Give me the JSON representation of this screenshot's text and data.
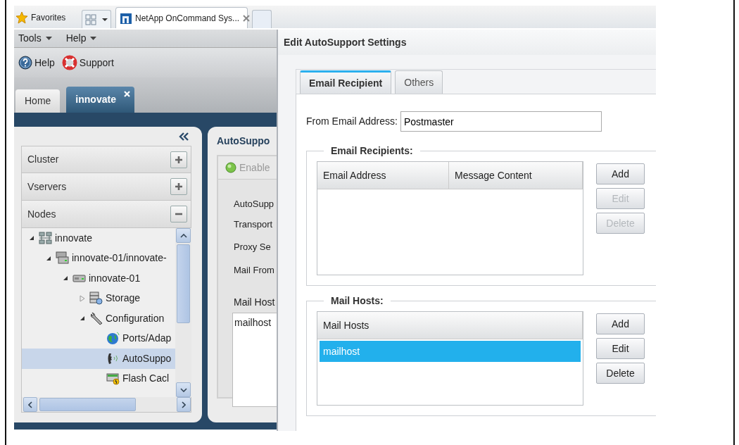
{
  "browser": {
    "favorites": "Favorites",
    "tabs": [
      {
        "title": "NetApp OnCommand Sys...",
        "selected": true
      }
    ]
  },
  "menu": [
    "Tools",
    "Help"
  ],
  "toolbar": [
    {
      "label": "Help",
      "kind": "help"
    },
    {
      "label": "Support",
      "kind": "support"
    }
  ],
  "app_tabs": [
    {
      "label": "Home",
      "selected": false,
      "closable": false
    },
    {
      "label": "innovate",
      "selected": true,
      "closable": true
    }
  ],
  "sidebar": {
    "sections": [
      {
        "label": "Cluster",
        "expanded": false
      },
      {
        "label": "Vservers",
        "expanded": false
      },
      {
        "label": "Nodes",
        "expanded": true
      }
    ],
    "tree": [
      {
        "label": "innovate",
        "kind": "cluster",
        "expanded": true,
        "selected": false,
        "children": [
          {
            "label": "innovate-01/innovate-",
            "kind": "pair",
            "expanded": true,
            "selected": false,
            "children": [
              {
                "label": "innovate-01",
                "kind": "node",
                "expanded": true,
                "selected": false,
                "children": [
                  {
                    "label": "Storage",
                    "kind": "storage",
                    "expanded": false,
                    "selected": false
                  },
                  {
                    "label": "Configuration",
                    "kind": "wrench",
                    "expanded": true,
                    "selected": false,
                    "children": [
                      {
                        "label": "Ports/Adap",
                        "kind": "globe",
                        "selected": false
                      },
                      {
                        "label": "AutoSuppo",
                        "kind": "phone",
                        "selected": true
                      },
                      {
                        "label": "Flash Cacl",
                        "kind": "flash",
                        "selected": false
                      }
                    ]
                  }
                ]
              }
            ]
          }
        ]
      }
    ]
  },
  "autosupport_panel": {
    "title": "AutoSuppo",
    "enable_button": {
      "label": "Enable",
      "disabled": true
    },
    "labels": [
      "AutoSupp",
      "Transport",
      "Proxy Se",
      "Mail From"
    ],
    "mail_host_label": "Mail Host",
    "mail_host_value": "mailhost"
  },
  "dialog": {
    "title": "Edit AutoSupport Settings",
    "tabs": [
      {
        "label": "Email Recipient",
        "selected": true
      },
      {
        "label": "Others",
        "selected": false
      }
    ],
    "from_email": {
      "label": "From Email Address:",
      "value": "Postmaster"
    },
    "recipients": {
      "legend": "Email Recipients:",
      "columns": [
        "Email Address",
        "Message Content"
      ],
      "buttons": [
        {
          "label": "Add",
          "disabled": false
        },
        {
          "label": "Edit",
          "disabled": true
        },
        {
          "label": "Delete",
          "disabled": true
        }
      ]
    },
    "mail_hosts": {
      "legend": "Mail Hosts:",
      "columns": [
        "Mail Hosts"
      ],
      "rows": [
        {
          "cells": [
            "mailhost"
          ],
          "selected": true
        }
      ],
      "buttons": [
        {
          "label": "Add",
          "disabled": false
        },
        {
          "label": "Edit",
          "disabled": false
        },
        {
          "label": "Delete",
          "disabled": false
        }
      ]
    }
  }
}
